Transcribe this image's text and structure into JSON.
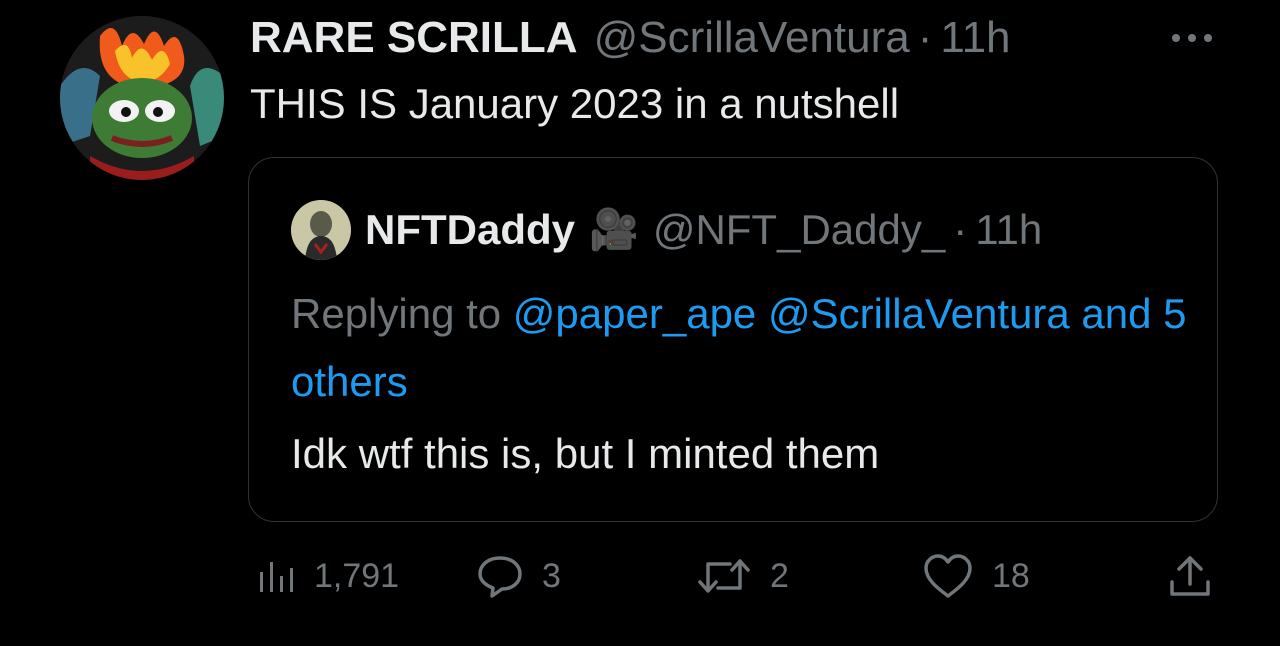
{
  "tweet": {
    "display_name": "RARE SCRILLA",
    "handle": "@ScrillaVentura",
    "separator": "·",
    "time": "11h",
    "text": "THIS IS January 2023 in a nutshell"
  },
  "quote": {
    "display_name": "NFTDaddy",
    "emoji": "🎥",
    "handle": "@NFT_Daddy_",
    "separator": "·",
    "time": "11h",
    "replying_prefix": "Replying to",
    "mentions": [
      "@paper_ape",
      "@ScrillaVentura"
    ],
    "others": "and 5 others",
    "text": "Idk wtf this is, but I minted them"
  },
  "actions": {
    "views": "1,791",
    "replies": "3",
    "retweets": "2",
    "likes": "18"
  },
  "icons": {
    "more": "more-horizontal-icon",
    "views": "analytics-bar-icon",
    "reply": "speech-bubble-icon",
    "retweet": "retweet-arrows-icon",
    "like": "heart-icon",
    "share": "share-upload-icon"
  },
  "colors": {
    "background": "#000000",
    "primary_text": "#e7e9ea",
    "secondary_text": "#71767b",
    "link": "#1d9bf0",
    "border": "#2f3336"
  }
}
